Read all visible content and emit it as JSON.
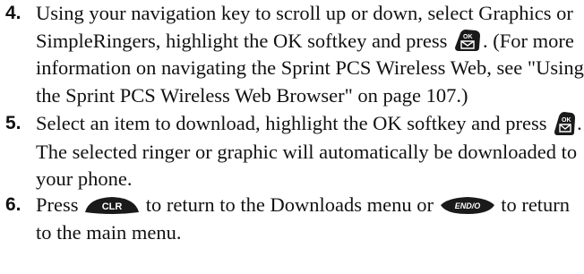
{
  "steps": [
    {
      "number": "4.",
      "text_a": "Using your navigation key to scroll up or down, select Graphics or SimpleRingers, highlight the OK softkey and press ",
      "text_b": ". (For more information on navigating the Sprint PCS Wireless Web, see \"Using the Sprint PCS Wireless Web Browser\" on page 107.)",
      "icon_label": "OK"
    },
    {
      "number": "5.",
      "text_a": "Select an item to download, highlight the OK softkey and press ",
      "text_b": ". The selected ringer or graphic will automatically be downloaded to your phone.",
      "icon_label": "OK"
    },
    {
      "number": "6.",
      "text_a": "Press ",
      "key_clr_label": "CLR",
      "text_b": " to return to the Downloads menu or ",
      "key_end_label": "END/O",
      "text_c": " to return to the main menu."
    }
  ],
  "colors": {
    "text": "#111111",
    "key_fill": "#1a1a1a",
    "key_text": "#ffffff"
  },
  "icons": [
    "ok-key-icon",
    "clr-key-icon",
    "end-key-icon"
  ]
}
